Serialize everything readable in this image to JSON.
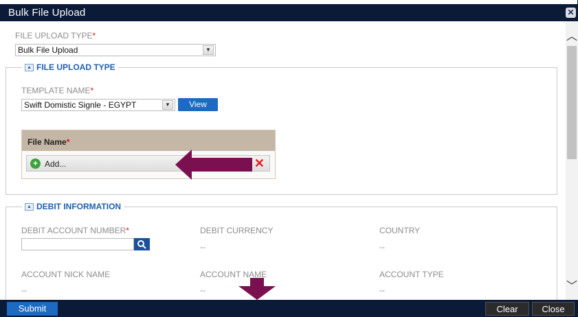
{
  "dialog": {
    "title": "Bulk File Upload",
    "close_icon": "close-icon"
  },
  "upload_type": {
    "label": "FILE UPLOAD TYPE",
    "required": "*",
    "value": "Bulk File Upload"
  },
  "file_section": {
    "legend": "FILE UPLOAD TYPE",
    "template_label": "TEMPLATE NAME",
    "template_required": "*",
    "template_value": "Swift Domistic Signle - EGYPT",
    "view_label": "View",
    "file_name_header": "File Name",
    "file_name_required": "*",
    "add_label": "Add..."
  },
  "debit_section": {
    "legend": "DEBIT INFORMATION",
    "account_number_label": "DEBIT ACCOUNT NUMBER",
    "account_number_required": "*",
    "account_number_value": "",
    "currency_label": "DEBIT CURRENCY",
    "currency_value": "--",
    "country_label": "COUNTRY",
    "country_value": "--",
    "nickname_label": "ACCOUNT NICK NAME",
    "nickname_value": "--",
    "account_name_label": "ACCOUNT NAME",
    "account_name_value": "--",
    "account_type_label": "ACCOUNT TYPE",
    "account_type_value": "--"
  },
  "footer": {
    "submit_label": "Submit",
    "clear_label": "Clear",
    "close_label": "Close"
  },
  "colors": {
    "titlebar": "#0b1a37",
    "accent_blue": "#1c6ac2",
    "legend_blue": "#1e5fae",
    "required_red": "#cc1a1a",
    "annotation_arrow": "#7b1050"
  }
}
